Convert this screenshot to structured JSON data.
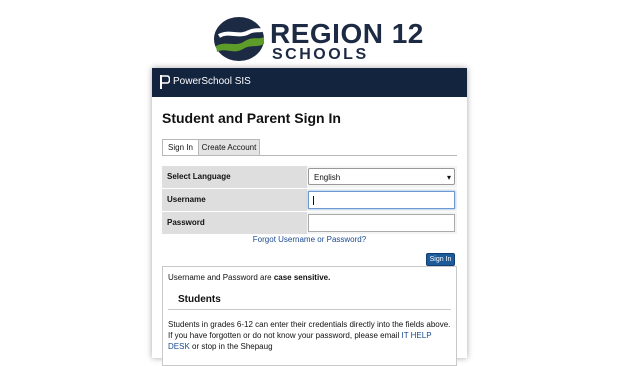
{
  "logo": {
    "line1": "REGION 12",
    "line2": "SCHOOLS",
    "colors": {
      "navy": "#1d2a44",
      "green": "#5e9c2a"
    }
  },
  "header": {
    "app_title": "PowerSchool SIS",
    "icon": "powerschool-logo-icon"
  },
  "page": {
    "heading": "Student and Parent Sign In"
  },
  "tabs": [
    {
      "label": "Sign In",
      "active": true
    },
    {
      "label": "Create Account",
      "active": false
    }
  ],
  "form": {
    "language_label": "Select Language",
    "language_value": "English",
    "username_label": "Username",
    "username_value": "",
    "password_label": "Password",
    "password_value": ""
  },
  "forgot_link": "Forgot Username or Password?",
  "signin_button": "Sign In",
  "info": {
    "line1_pre": "Username and Password are ",
    "line1_bold": "case sensitive.",
    "students_title": "Students",
    "para_pre": "Students in grades 6-12 can enter their credentials directly into the fields above. If you have forgotten or do not know your password, please email ",
    "para_link": "IT HELP DESK",
    "para_post": " or stop in the Shepaug"
  }
}
